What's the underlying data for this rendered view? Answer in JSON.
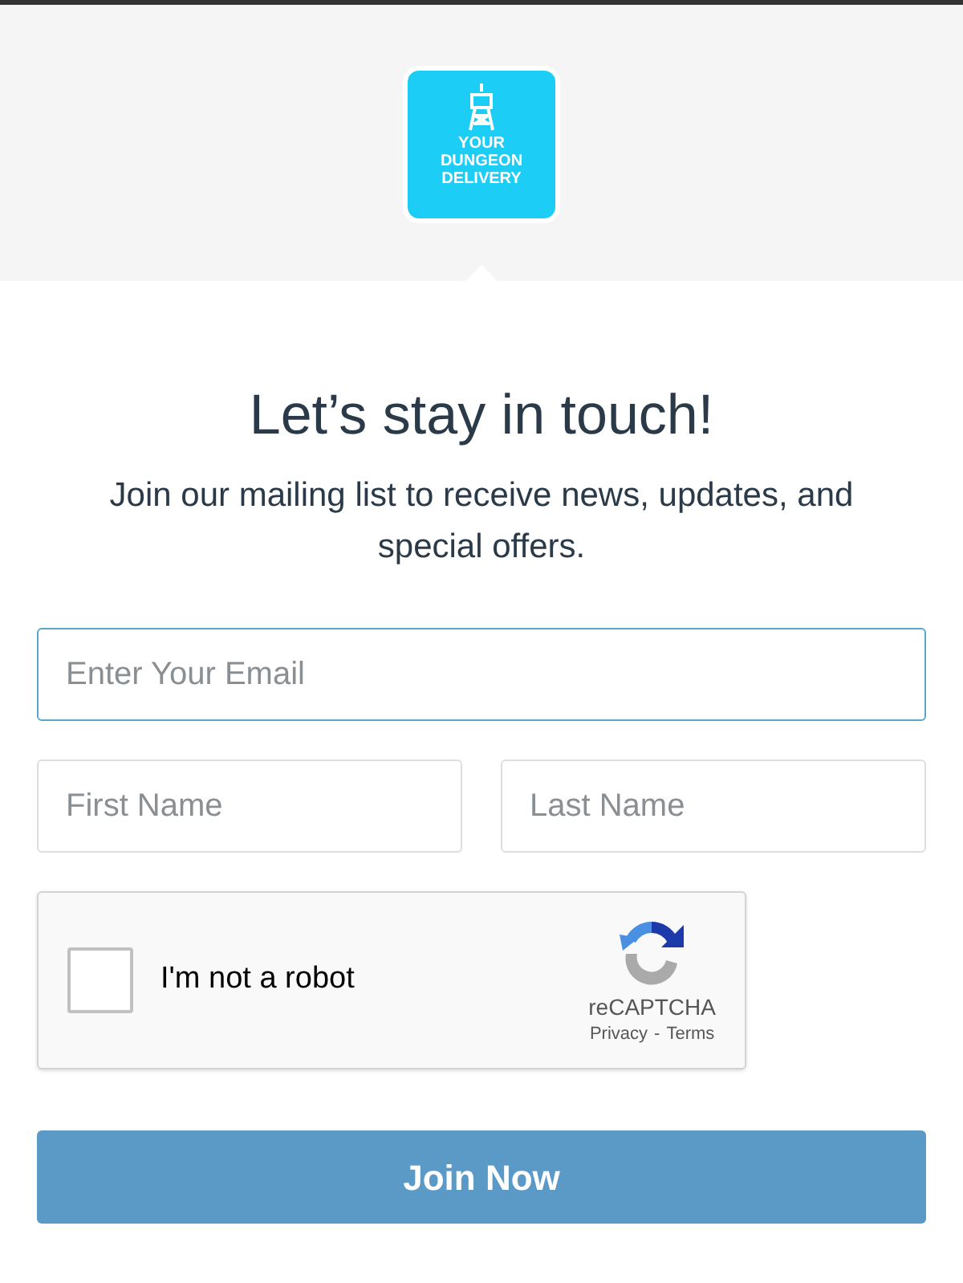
{
  "logo": {
    "lines": [
      "YOUR",
      "DUNGEON",
      "DELIVERY"
    ]
  },
  "heading": "Let’s stay in touch!",
  "subheading": "Join our mailing list to receive news, updates, and special offers.",
  "email": {
    "placeholder": "Enter Your Email",
    "focused": true
  },
  "first_name": {
    "placeholder": "First Name"
  },
  "last_name": {
    "placeholder": "Last Name"
  },
  "captcha": {
    "label": "I'm not a robot",
    "checked": false,
    "brand": "reCAPTCHA",
    "privacy": "Privacy",
    "separator": "-",
    "terms": "Terms"
  },
  "submit": "Join Now"
}
